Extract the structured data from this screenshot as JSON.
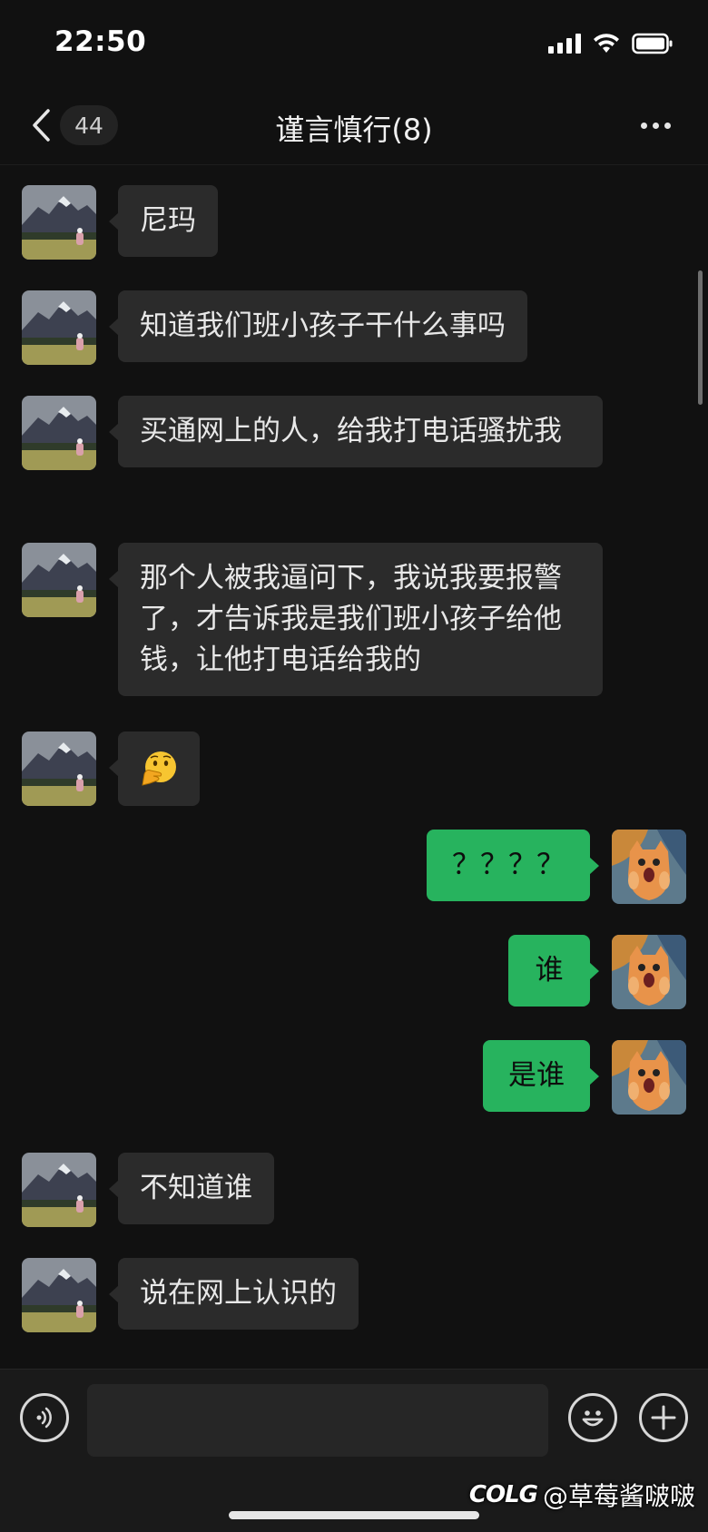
{
  "status_bar": {
    "time": "22:50"
  },
  "nav": {
    "unread_count": "44",
    "title": "谨言慎行(8)"
  },
  "messages": [
    {
      "side": "left",
      "text": "尼玛"
    },
    {
      "side": "left",
      "text": "知道我们班小孩子干什么事吗"
    },
    {
      "side": "left",
      "text": "买通网上的人，给我打电话骚扰我"
    },
    {
      "side": "left",
      "text": "那个人被我逼问下，我说我要报警了，才告诉我是我们班小孩子给他钱，让他打电话给我的"
    },
    {
      "side": "left",
      "text": "🫢",
      "icon": "hand-over-mouth-emoji"
    },
    {
      "side": "right",
      "text": "？？？？"
    },
    {
      "side": "right",
      "text": "谁"
    },
    {
      "side": "right",
      "text": "是谁"
    },
    {
      "side": "left",
      "text": "不知道谁"
    },
    {
      "side": "left",
      "text": "说在网上认识的"
    }
  ],
  "input": {
    "value": "",
    "placeholder": ""
  },
  "watermark": {
    "logo": "COLG",
    "text": "@草莓酱啵啵"
  },
  "colors": {
    "background": "#111111",
    "incoming_bubble": "#2b2b2b",
    "outgoing_bubble": "#27b35e"
  }
}
